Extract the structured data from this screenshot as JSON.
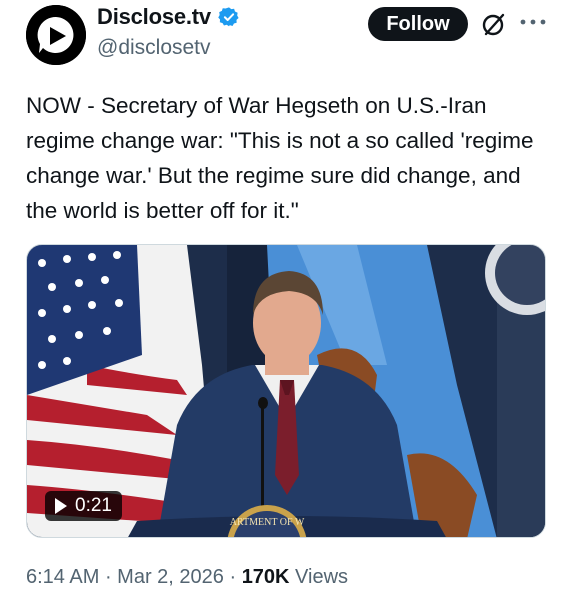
{
  "author": {
    "display_name": "Disclose.tv",
    "handle": "@disclosetv",
    "verified": true,
    "avatar_icon": "disclose-tv-logo-icon"
  },
  "actions": {
    "follow_label": "Follow",
    "grok_icon": "grok-icon",
    "more_icon": "more-options-icon"
  },
  "tweet": {
    "text": "NOW - Secretary of War Hegseth on U.S.-Iran regime change war: \"This is not a so called 'regime change war.' But the regime sure did change, and the world is better off for it.\""
  },
  "media": {
    "type": "video",
    "duration": "0:21",
    "podium_text": "ARTMENT OF W"
  },
  "meta": {
    "time": "6:14 AM",
    "separator": " · ",
    "date": "Mar 2, 2026",
    "views_count": "170K",
    "views_label": " Views"
  },
  "colors": {
    "text_primary": "#0f1419",
    "text_secondary": "#536471",
    "verified_blue": "#1d9bf0"
  }
}
